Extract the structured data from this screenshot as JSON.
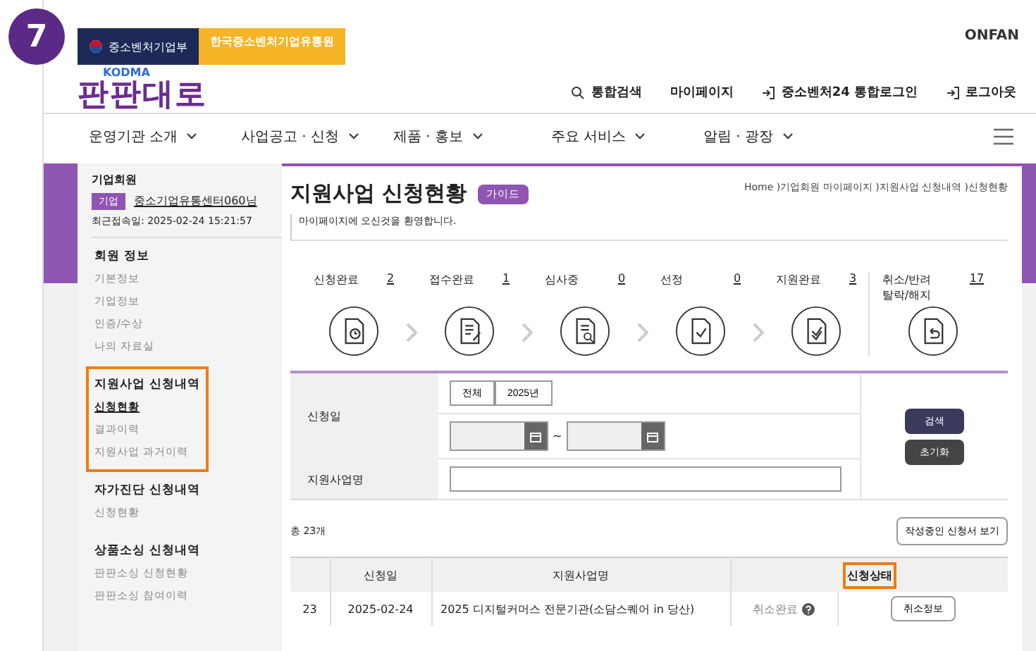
{
  "step_badge": "7",
  "header": {
    "ministry": "중소벤처기업부",
    "agency": "한국중소벤처기업유통원",
    "logo_sub": "KODMA",
    "logo": "판판대로",
    "brand": "ONFAN",
    "links": [
      {
        "label": "통합검색",
        "kind": "search"
      },
      {
        "label": "마이페이지",
        "kind": "plain"
      },
      {
        "label": "중소벤처24 통합로그인",
        "kind": "login"
      },
      {
        "label": "로그아웃",
        "kind": "login"
      }
    ]
  },
  "nav": [
    "운영기관 소개",
    "사업공고 · 신청",
    "제품 · 홍보",
    "주요 서비스",
    "알림 · 광장"
  ],
  "sidebar": {
    "member_type": "기업회원",
    "tag": "기업",
    "name": "중소기업유통센터060님",
    "last_login": "최근접속일: 2025-02-24 15:21:57",
    "sections": [
      {
        "title": "회원 정보",
        "items": [
          {
            "label": "기본정보",
            "selected": false
          },
          {
            "label": "기업정보",
            "selected": false
          },
          {
            "label": "인증/수상",
            "selected": false
          },
          {
            "label": "나의 자료실",
            "selected": false
          }
        ]
      },
      {
        "title": "지원사업 신청내역",
        "highlighted": true,
        "items": [
          {
            "label": "신청현황",
            "selected": true
          },
          {
            "label": "결과이력",
            "selected": false
          },
          {
            "label": "지원사업 과거이력",
            "selected": false
          }
        ]
      },
      {
        "title": "자가진단 신청내역",
        "items": [
          {
            "label": "신청현황",
            "selected": false
          }
        ]
      },
      {
        "title": "상품소싱 신청내역",
        "items": [
          {
            "label": "판판소싱 신청현황",
            "selected": false
          },
          {
            "label": "판판소싱 참여이력",
            "selected": false
          }
        ]
      }
    ]
  },
  "page": {
    "title": "지원사업 신청현황",
    "guide": "가이드",
    "subtitle": "마이페이지에 오신것을 환영합니다.",
    "breadcrumb": "Home )기업회원 마이페이지 )지원사업 신청내역 )신청현황"
  },
  "steps": [
    {
      "label": [
        "신청완료"
      ],
      "count": "2",
      "kind": "clock"
    },
    {
      "label": [
        "접수완료"
      ],
      "count": "1",
      "kind": "pen"
    },
    {
      "label": [
        "심사중"
      ],
      "count": "0",
      "kind": "magnifier"
    },
    {
      "label": [
        "선정"
      ],
      "count": "0",
      "kind": "check"
    },
    {
      "label": [
        "지원완료"
      ],
      "count": "3",
      "kind": "double-check"
    },
    {
      "label": [
        "취소/반려",
        "탈락/해지"
      ],
      "count": "17",
      "kind": "return"
    }
  ],
  "filter": {
    "date_label": "신청일",
    "periods": [
      {
        "label": "전체"
      },
      {
        "label": "2025년"
      }
    ],
    "range_sep": "~",
    "name_label": "지원사업명",
    "search": "검색",
    "reset": "초기화"
  },
  "list": {
    "total": "총 23개",
    "drafts_button": "작성중인 신청서 보기",
    "columns": [
      {
        "label": "신청일"
      },
      {
        "label": "지원사업명"
      },
      {
        "label": "신청상태",
        "highlighted": true
      }
    ],
    "rows": [
      {
        "no": "23",
        "date": "2025-02-24",
        "name": "2025 디지털커머스 전문기관(소담스퀘어 in 당산)",
        "status": "취소완료",
        "action": "취소정보"
      }
    ]
  }
}
